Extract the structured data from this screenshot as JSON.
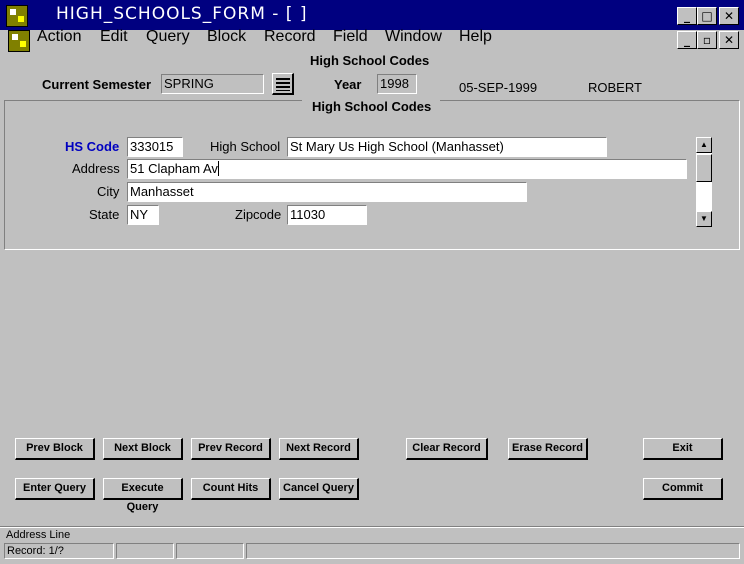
{
  "window": {
    "title": "HIGH_SCHOOLS_FORM - [ ]"
  },
  "menu": [
    "Action",
    "Edit",
    "Query",
    "Block",
    "Record",
    "Field",
    "Window",
    "Help"
  ],
  "header": {
    "block_title": "High School Codes",
    "current_semester_label": "Current Semester",
    "current_semester_value": "SPRING",
    "year_label": "Year",
    "year_value": "1998",
    "date": "05-SEP-1999",
    "user": "ROBERT"
  },
  "record": {
    "section_title": "High School Codes",
    "hs_code_label": "HS Code",
    "hs_code_value": "333015",
    "high_school_label": "High School",
    "high_school_value": "St Mary Us High School (Manhasset)",
    "address_label": "Address",
    "address_value": "51 Clapham Av",
    "city_label": "City",
    "city_value": "Manhasset",
    "state_label": "State",
    "state_value": "NY",
    "zipcode_label": "Zipcode",
    "zipcode_value": "11030"
  },
  "buttons": {
    "prev_block": "Prev Block",
    "next_block": "Next Block",
    "prev_record": "Prev Record",
    "next_record": "Next Record",
    "clear_record": "Clear Record",
    "erase_record": "Erase Record",
    "exit": "Exit",
    "enter_query": "Enter Query",
    "execute_query": "Execute Query",
    "count_hits": "Count Hits",
    "cancel_query": "Cancel Query",
    "commit": "Commit"
  },
  "status": {
    "hint": "Address Line",
    "record": "Record: 1/?"
  }
}
